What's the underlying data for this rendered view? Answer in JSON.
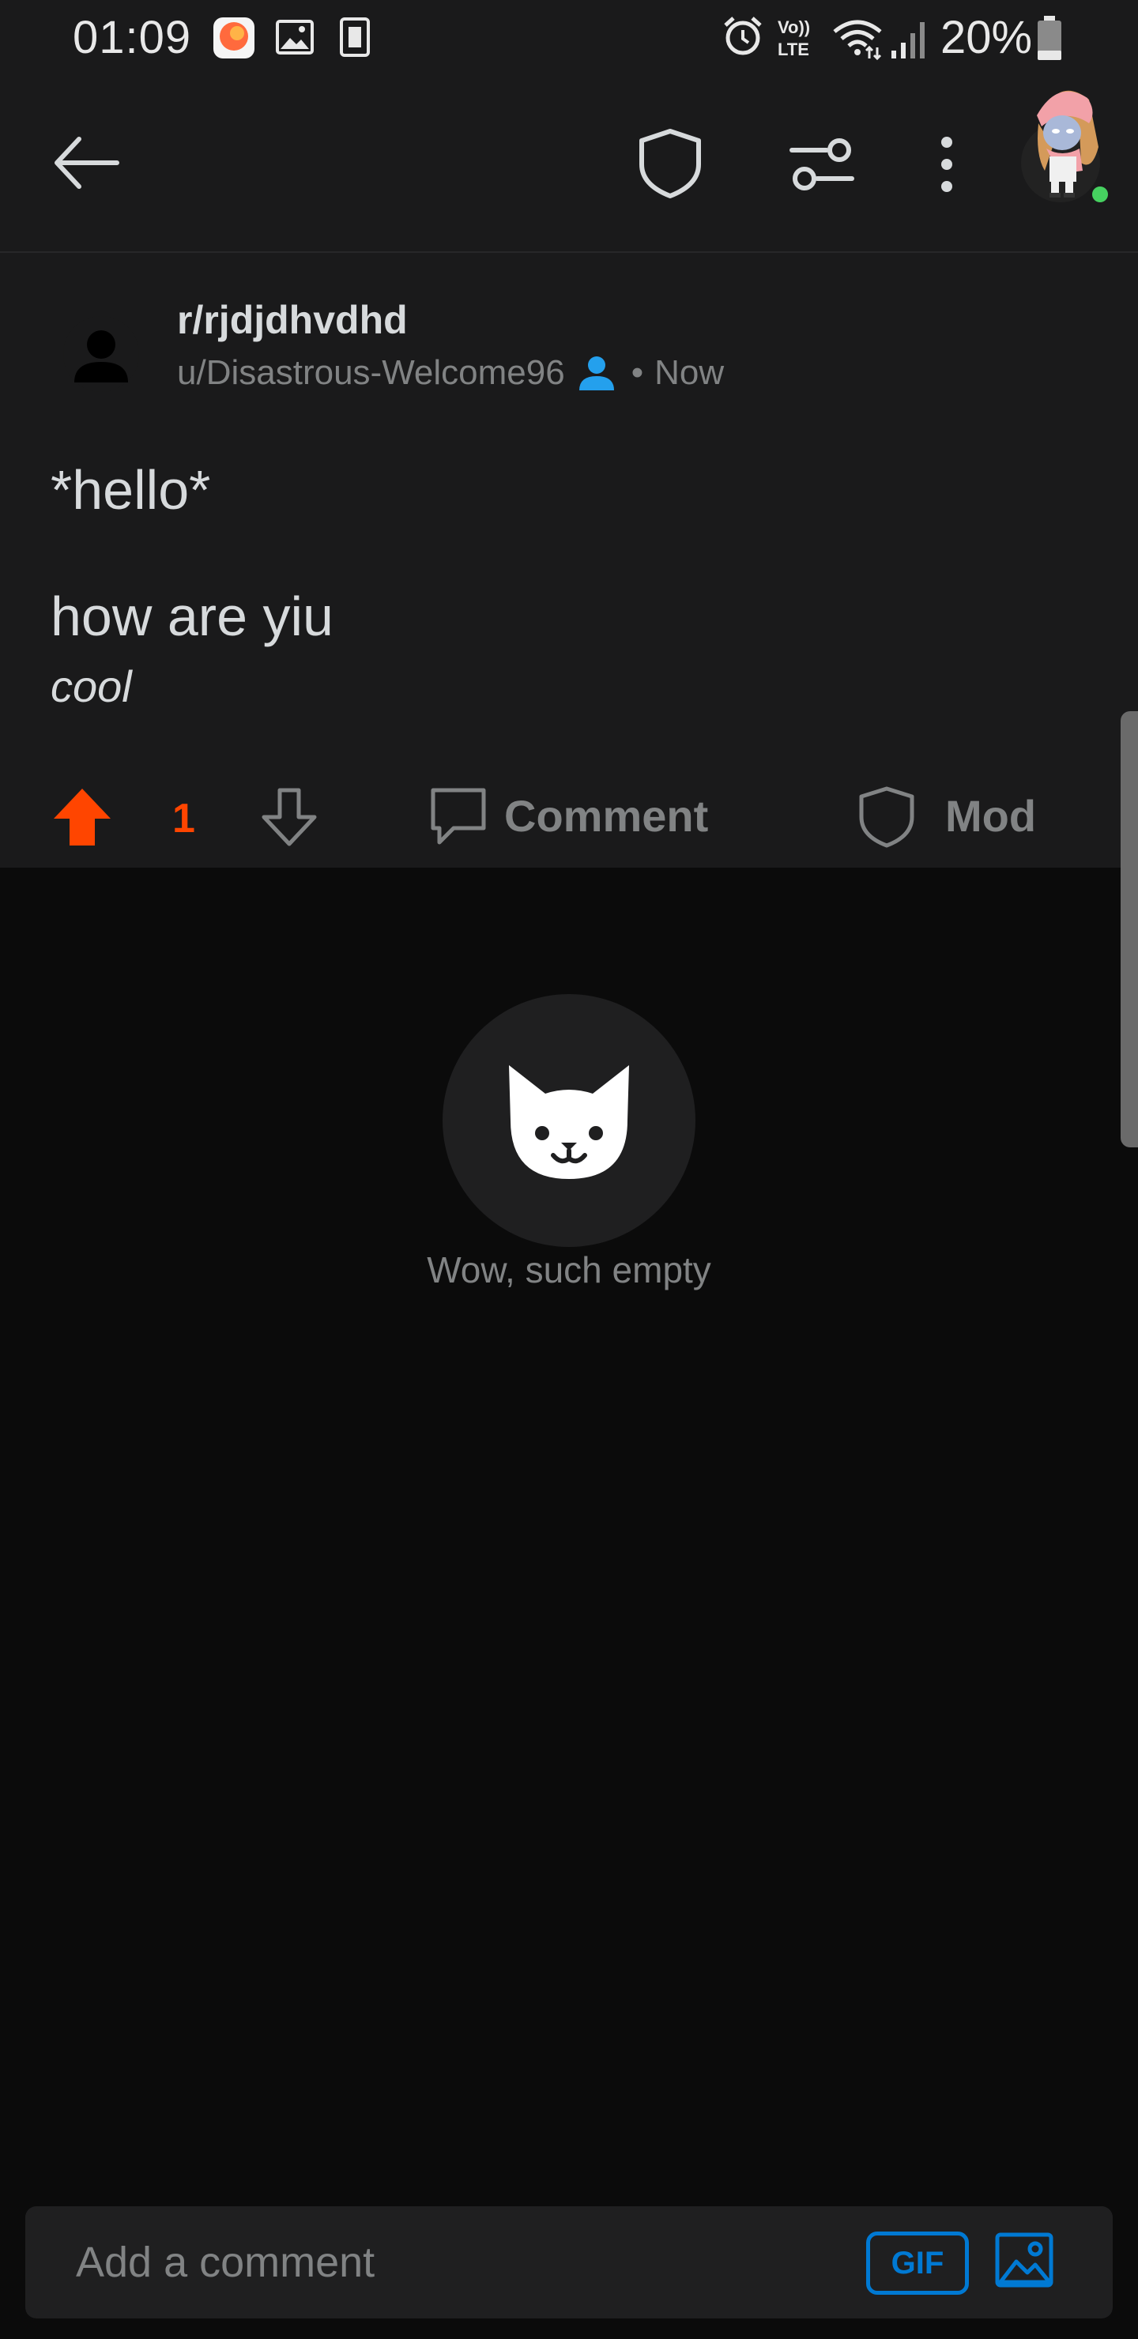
{
  "status_bar": {
    "time": "01:09",
    "battery": "20%",
    "icons": [
      "notification-app-icon",
      "gallery-icon",
      "sim-icon",
      "alarm-icon",
      "volte-icon",
      "wifi-icon",
      "signal-icon",
      "battery-icon"
    ],
    "volte_label": "Vo))\nLTE"
  },
  "header": {
    "icons": [
      "back-arrow-icon",
      "shield-icon",
      "filter-settings-icon",
      "more-vertical-icon",
      "profile-avatar"
    ]
  },
  "post": {
    "subreddit": "r/rjdjdhvdhd",
    "author": "u/Disastrous-Welcome96",
    "separator": "•",
    "time": "Now",
    "title": "*hello*",
    "body_line": "how are yiu",
    "body_italic": "cool"
  },
  "actions": {
    "vote_count": "1",
    "comment_label": "Comment",
    "mod_label": "Mod"
  },
  "empty_state": {
    "text": "Wow, such empty"
  },
  "comment_bar": {
    "placeholder": "Add a comment",
    "gif_label": "GIF"
  },
  "colors": {
    "upvote": "#ff4500",
    "accent_blue": "#0079d3",
    "online": "#46d160",
    "background": "#0b0b0b",
    "card": "#1a1a1b"
  }
}
